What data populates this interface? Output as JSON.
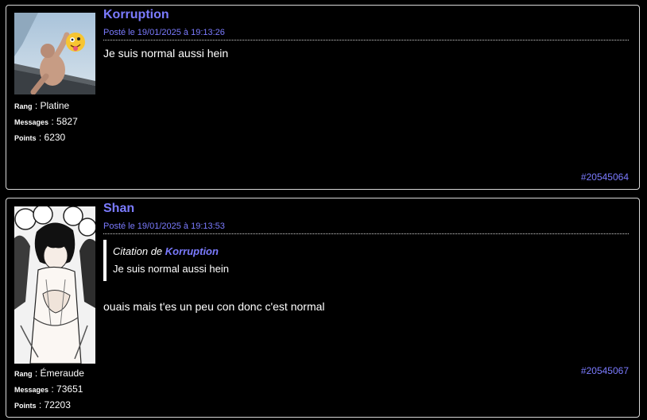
{
  "posts": [
    {
      "author": "Korruption",
      "date": "Posté le 19/01/2025 à 19:13:26",
      "text": "Je suis normal aussi hein",
      "rank_label": "Rang",
      "rank": "Platine",
      "messages_label": "Messages",
      "messages": "5827",
      "points_label": "Points",
      "points": "6230",
      "post_id": "#20545064",
      "avatar": "avatar-korruption"
    },
    {
      "author": "Shan",
      "date": "Posté le 19/01/2025 à 19:13:53",
      "quote_prefix": "Citation de",
      "quote_author": "Korruption",
      "quote_text": "Je suis normal aussi hein",
      "text": "ouais mais t'es un peu con donc c'est normal",
      "rank_label": "Rang",
      "rank": "Émeraude",
      "messages_label": "Messages",
      "messages": "73651",
      "points_label": "Points",
      "points": "72203",
      "post_id": "#20545067",
      "avatar": "avatar-shan"
    }
  ]
}
